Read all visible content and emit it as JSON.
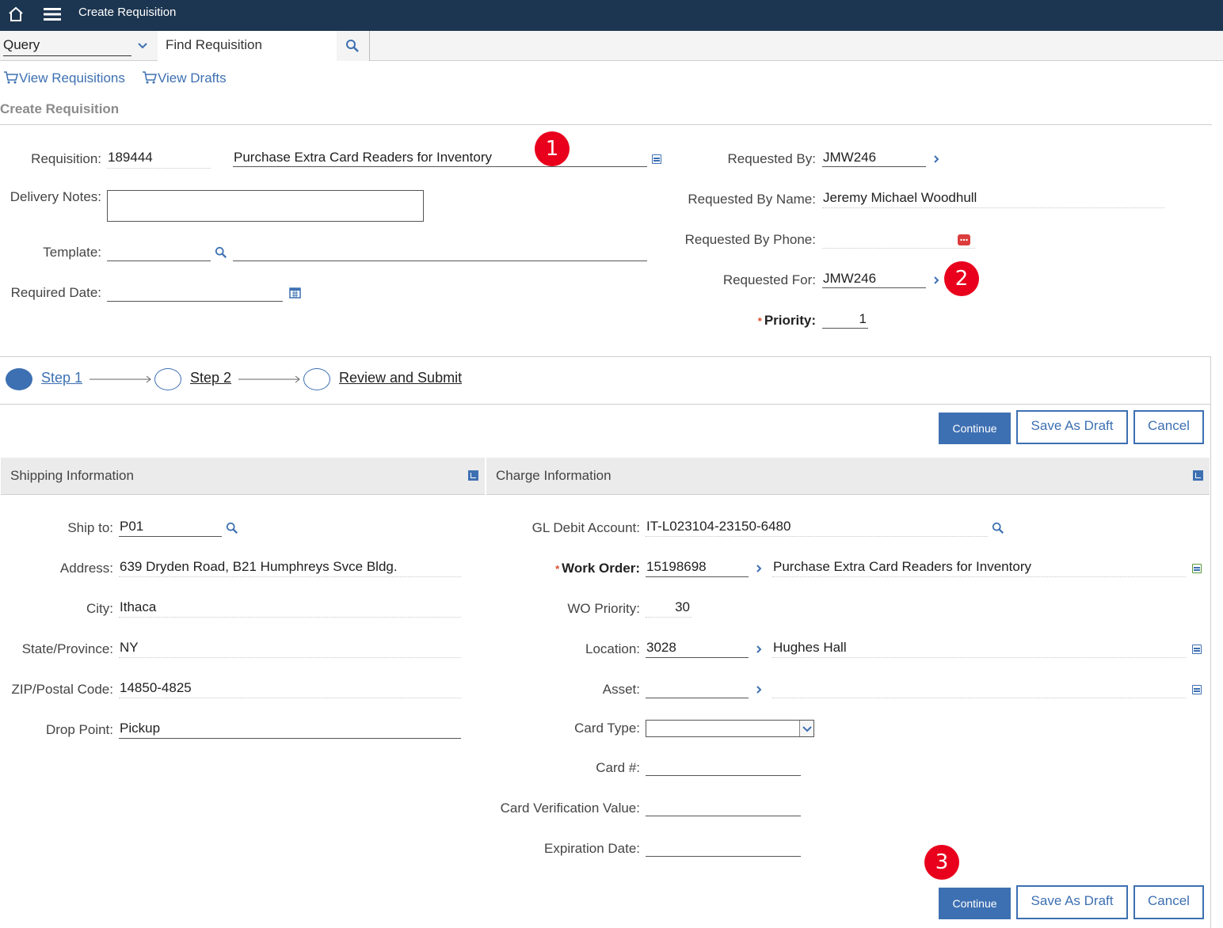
{
  "topbar": {
    "title": "Create Requisition"
  },
  "query": {
    "select_value": "Query",
    "find_placeholder": "Find Requisition"
  },
  "links": {
    "view_requisitions": "View Requisitions",
    "view_drafts": "View Drafts"
  },
  "page_title": "Create Requisition",
  "header": {
    "requisition_label": "Requisition:",
    "requisition_value": "189444",
    "description_value": "Purchase Extra Card Readers for Inventory",
    "delivery_notes_label": "Delivery Notes:",
    "template_label": "Template:",
    "required_date_label": "Required Date:",
    "requested_by_label": "Requested By:",
    "requested_by_value": "JMW246",
    "requested_by_name_label": "Requested By Name:",
    "requested_by_name_value": "Jeremy Michael Woodhull",
    "requested_by_phone_label": "Requested By Phone:",
    "requested_for_label": "Requested For:",
    "requested_for_value": "JMW246",
    "priority_label": "Priority:",
    "priority_value": "1"
  },
  "badges": [
    "1",
    "2",
    "3"
  ],
  "steps": [
    "Step 1",
    "Step 2",
    "Review and Submit"
  ],
  "buttons": {
    "continue": "Continue",
    "save_draft": "Save As Draft",
    "cancel": "Cancel"
  },
  "shipping": {
    "title": "Shipping Information",
    "ship_to_label": "Ship to:",
    "ship_to_value": "P01",
    "address_label": "Address:",
    "address_value": "639 Dryden Road, B21 Humphreys Svce Bldg.",
    "city_label": "City:",
    "city_value": "Ithaca",
    "state_label": "State/Province:",
    "state_value": "NY",
    "zip_label": "ZIP/Postal Code:",
    "zip_value": "14850-4825",
    "drop_label": "Drop Point:",
    "drop_value": "Pickup"
  },
  "charge": {
    "title": "Charge Information",
    "gl_label": "GL Debit Account:",
    "gl_value": "IT-L023104-23150-6480",
    "wo_label": "Work Order:",
    "wo_value": "15198698",
    "wo_desc": "Purchase Extra Card Readers for Inventory",
    "wo_priority_label": "WO Priority:",
    "wo_priority_value": "30",
    "location_label": "Location:",
    "location_value": "3028",
    "location_desc": "Hughes Hall",
    "asset_label": "Asset:",
    "card_type_label": "Card Type:",
    "card_num_label": "Card #:",
    "cvv_label": "Card Verification Value:",
    "exp_label": "Expiration Date:"
  },
  "colors": {
    "topbar": "#1c3550",
    "accent": "#3d70b2",
    "badge": "#e8001c"
  }
}
